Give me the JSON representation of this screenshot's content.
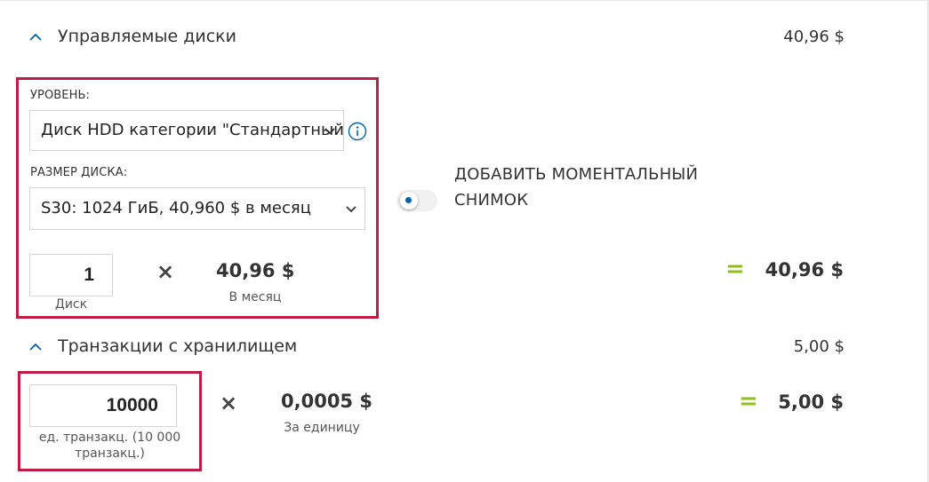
{
  "managed_disks": {
    "title": "Управляемые диски",
    "total": "40,96 $",
    "tier_label": "УРОВЕНЬ:",
    "tier_value": "Диск HDD категории \"Стандартный\"",
    "disk_size_label": "РАЗМЕР ДИСКА:",
    "disk_size_value": "S30: 1024 ГиБ, 40,960 $ в месяц",
    "quantity": "1",
    "quantity_unit": "Диск",
    "times": "×",
    "unit_price": "40,96 $",
    "unit_price_period": "В месяц",
    "equals": "=",
    "result": "40,96 $",
    "snapshot_toggle_label_line1": "ДОБАВИТЬ МОМЕНТАЛЬНЫЙ",
    "snapshot_toggle_label_line2": "СНИМОК",
    "snapshot_toggle_on": false
  },
  "storage_transactions": {
    "title": "Транзакции с хранилищем",
    "total": "5,00 $",
    "quantity": "10000",
    "quantity_unit_line1": "ед. транзакц. (10 000",
    "quantity_unit_line2": "транзакц.)",
    "times": "×",
    "unit_price": "0,0005 $",
    "unit_price_period": "За единицу",
    "equals": "=",
    "result": "5,00 $"
  },
  "colors": {
    "accent_blue": "#0063b1",
    "highlight_red": "#c01b45",
    "equals_green": "#8fbf1a"
  },
  "icons": {
    "collapse": "chevron-up-icon",
    "dropdown": "chevron-down-icon",
    "info": "info-icon"
  }
}
